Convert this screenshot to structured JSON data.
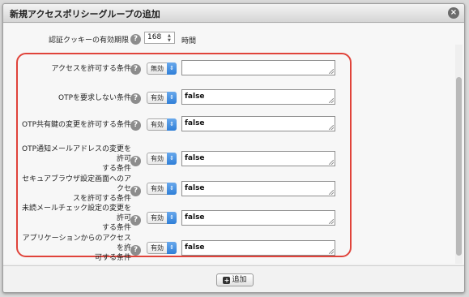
{
  "dialog": {
    "title": "新規アクセスポリシーグループの追加",
    "close_label": "×"
  },
  "cookie": {
    "label": "認証クッキーの有効期限",
    "value": "168",
    "unit": "時間"
  },
  "help_glyph": "?",
  "select_arrow_glyph": "⇕",
  "conditions": [
    {
      "label": [
        "アクセスを許可する条件"
      ],
      "select": "無効",
      "value": ""
    },
    {
      "label": [
        "OTPを要求しない条件"
      ],
      "select": "有効",
      "value": "false"
    },
    {
      "label": [
        "OTP共有鍵の変更を許可する条件"
      ],
      "select": "有効",
      "value": "false"
    },
    {
      "label": [
        "OTP通知メールアドレスの変更を許可",
        "する条件"
      ],
      "select": "有効",
      "value": "false"
    },
    {
      "label": [
        "セキュアブラウザ設定画面へのアクセ",
        "スを許可する条件"
      ],
      "select": "有効",
      "value": "false"
    },
    {
      "label": [
        "未読メールチェック設定の変更を許可",
        "する条件"
      ],
      "select": "有効",
      "value": "false"
    },
    {
      "label": [
        "アプリケーションからのアクセスを許",
        "可する条件"
      ],
      "select": "有効",
      "value": "false"
    }
  ],
  "footer": {
    "add_label": "追加",
    "add_icon": "+"
  },
  "colors": {
    "highlight": "#e0433a",
    "select_accent": "#2f7fd8"
  }
}
